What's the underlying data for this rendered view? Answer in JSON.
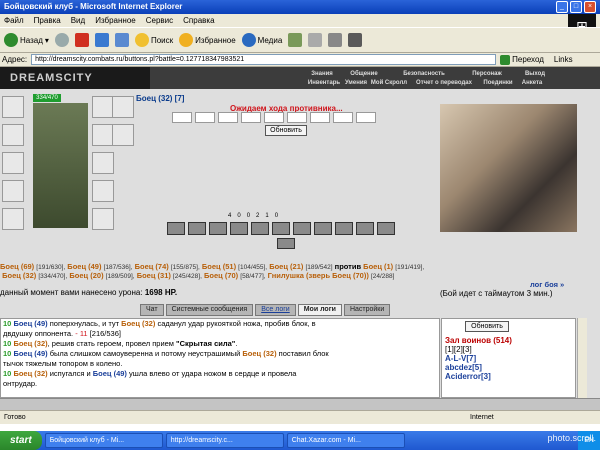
{
  "window": {
    "title": "Бойцовский клуб - Microsoft Internet Explorer"
  },
  "menu": [
    "Файл",
    "Правка",
    "Вид",
    "Избранное",
    "Сервис",
    "Справка"
  ],
  "toolbar": {
    "back": "Назад",
    "search": "Поиск",
    "favorites": "Избранное",
    "media": "Медиа"
  },
  "address": {
    "label": "Адрес:",
    "url": "http://dreamscity.combats.ru/buttons.pl?battle=0.127718347983521",
    "go": "Переход",
    "links": "Links"
  },
  "site": {
    "logo": "DREAMSCITY",
    "nav_top": [
      "Знания",
      "Общение",
      "Безопасность",
      "Персонаж",
      "Выход"
    ],
    "nav_bottom": [
      "Инвентарь",
      "Умения",
      "Мой Скролл",
      "Отчет о переводах",
      "Поединки",
      "Анкета"
    ]
  },
  "player": {
    "hp": "334/470",
    "name": "Боец (32) [7]"
  },
  "battle": {
    "waiting": "Ожидаем хода противника...",
    "refresh": "Обновить",
    "stats": [
      "4",
      "0",
      "0",
      "2",
      "1",
      "0"
    ],
    "line1": {
      "team_a": [
        {
          "name": "Боец (69)",
          "hp": "[191/630],"
        },
        {
          "name": "Боец (49)",
          "hp": "[187/536],"
        },
        {
          "name": "Боец (74)",
          "hp": "[155/875],"
        },
        {
          "name": "Боец (51)",
          "hp": "[104/455],"
        },
        {
          "name": "Боец (21)",
          "hp": "[189/542]"
        }
      ],
      "vs": "против",
      "team_b_first": {
        "name": "Боец (1)",
        "hp": "[191/419],"
      }
    },
    "line2": [
      {
        "name": "Боец (32)",
        "hp": "[334/470],"
      },
      {
        "name": "Боец (20)",
        "hp": "[189/509],"
      },
      {
        "name": "Боец (31)",
        "hp": "[245/428],"
      },
      {
        "name": "Боец (70)",
        "hp": "[58/477],"
      },
      {
        "name": "Гнилушка (зверь Боец (70))",
        "hp": "[24/288]"
      }
    ],
    "log_link": "лог боя »",
    "damage": "данный момент вами нанесено урона:",
    "damage_value": "1698 HP.",
    "timeout": "(Бой идет с таймаутом 3 мин.)"
  },
  "tabs": [
    "Чат",
    "Системные сообщения",
    "Все логи",
    "Мои логи",
    "Настройки"
  ],
  "chat": [
    {
      "ts": "10",
      "pre": "",
      "a": "Боец (49)",
      "mid": " поперхнулась, и тут ",
      "b": "Боец (32)",
      "post": " саданул удар рукояткой ножа, пробив блок, в"
    },
    {
      "cont": "двдушку оппонента. ",
      "hp": "- 11",
      "tail": " [216/536]"
    },
    {
      "ts": "10",
      "pre": "",
      "a": "Боец (32)",
      "mid": ", решив стать героем, провел прием ",
      "bold": "\"Скрытая сила\"",
      "post": "."
    },
    {
      "ts": "10",
      "pre": "",
      "a": "Боец (49)",
      "mid": " была слишком самоуверенна и потому неустрашимый ",
      "b": "Боец (32)",
      "post": " поставил блок"
    },
    {
      "cont": "тычок тяжелым топором в колено."
    },
    {
      "ts": "10",
      "pre": "",
      "a": "Боец (32)",
      "mid": " испугался и ",
      "b": "Боец (49)",
      "post": " ушла влево от удара ножом в сердце и провела"
    },
    {
      "cont": "онтрудар."
    }
  ],
  "sidebar": {
    "refresh": "Обновить",
    "title": "Зал воинов (514)",
    "pages": "[1][2][3]",
    "users": [
      "A-L-V[7]",
      "abcdez[5]",
      "Aciderror[3]"
    ]
  },
  "status": {
    "text": "Готово",
    "zone": "Internet"
  },
  "taskbar": {
    "start": "start",
    "tasks": [
      "Бойцовский клуб - Mi...",
      "http://dreamscity.c...",
      "Chat.Xazar.com - Mi..."
    ],
    "lang": "EN"
  },
  "watermark": "photo.scroll."
}
